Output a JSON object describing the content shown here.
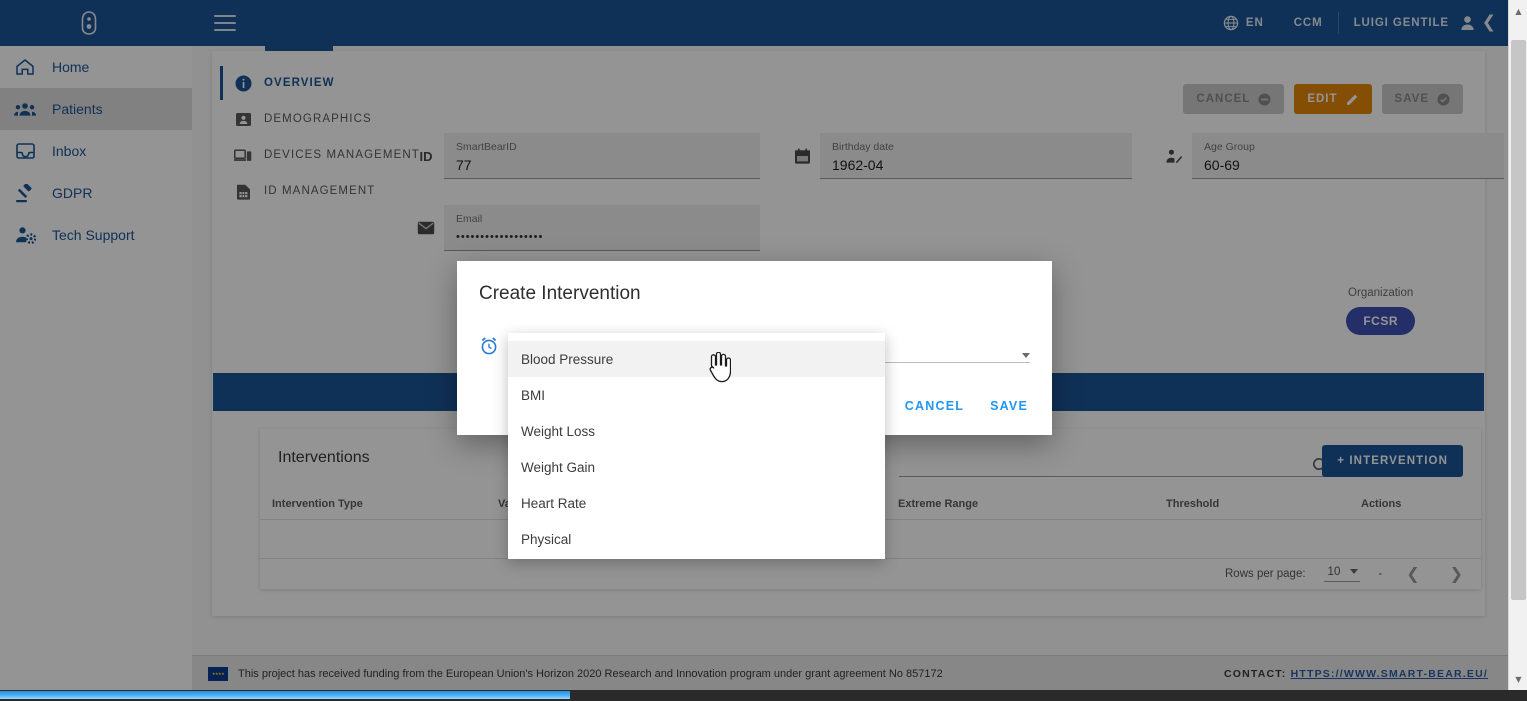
{
  "topbar": {
    "brand_icon": "bear-logo-icon",
    "collapse_icon": "chevron-left-icon",
    "menu_icon": "hamburger-menu-icon",
    "language": "EN",
    "project": "CCM",
    "user": "LUIGI GENTILE"
  },
  "sidebar": {
    "items": [
      {
        "label": "Home",
        "icon": "home-icon",
        "active": false
      },
      {
        "label": "Patients",
        "icon": "people-icon",
        "active": true
      },
      {
        "label": "Inbox",
        "icon": "inbox-icon",
        "active": false
      },
      {
        "label": "GDPR",
        "icon": "gavel-icon",
        "active": false
      },
      {
        "label": "Tech Support",
        "icon": "support-agent-icon",
        "active": false
      }
    ]
  },
  "section_tabs": [
    {
      "label": "OVERVIEW",
      "icon": "info-icon",
      "active": true
    },
    {
      "label": "DEMOGRAPHICS",
      "icon": "badge-person-icon",
      "active": false
    },
    {
      "label": "DEVICES MANAGEMENT",
      "icon": "devices-icon",
      "active": false
    },
    {
      "label": "ID MANAGEMENT",
      "icon": "sim-card-icon",
      "active": false
    }
  ],
  "actions": {
    "cancel": "CANCEL",
    "edit": "EDIT",
    "save": "SAVE"
  },
  "form": {
    "smartbear_id": {
      "label": "SmartBearID",
      "value": "77",
      "icon": "id-icon"
    },
    "birthday": {
      "label": "Birthday date",
      "value": "1962-04",
      "icon": "calendar-icon"
    },
    "age_group": {
      "label": "Age Group",
      "value": "60-69",
      "icon": "age-person-icon"
    },
    "email": {
      "label": "Email",
      "value": "••••••••••••••••••",
      "icon": "mail-icon"
    }
  },
  "organization": {
    "label": "Organization",
    "chip": "FCSR",
    "chip_color": "#3f51b5"
  },
  "interventions": {
    "title": "Interventions",
    "search_placeholder": "",
    "search_value": "",
    "add_button": "+ INTERVENTION",
    "columns": [
      "Intervention Type",
      "Value",
      "Extreme Range",
      "Threshold",
      "Actions"
    ],
    "rows": [
      [
        "",
        "",
        "",
        "",
        ""
      ]
    ],
    "pager": {
      "rows_per_page_label": "Rows per page:",
      "rows_per_page_value": "10",
      "range": "-",
      "prev_icon": "chevron-left-icon",
      "next_icon": "chevron-right-icon"
    }
  },
  "modal": {
    "title": "Create Intervention",
    "field_icon": "alarm-clock-icon",
    "field_value": "",
    "cancel": "CANCEL",
    "save": "SAVE"
  },
  "dropdown": {
    "items": [
      {
        "label": "Blood Pressure",
        "hover": true
      },
      {
        "label": "BMI",
        "hover": false
      },
      {
        "label": "Weight Loss",
        "hover": false
      },
      {
        "label": "Weight Gain",
        "hover": false
      },
      {
        "label": "Heart Rate",
        "hover": false
      },
      {
        "label": "Physical",
        "hover": false
      }
    ]
  },
  "footer": {
    "text": "This project has received funding from the European Union's Horizon 2020 Research and Innovation program under grant agreement No 857172",
    "contact_label": "CONTACT:",
    "contact_link": "HTTPS://WWW.SMART-BEAR.EU/"
  },
  "colors": {
    "header_blue": "#1d5596",
    "accent_orange": "#e3870a",
    "link_blue": "#2196f3",
    "chip_indigo": "#3f51b5"
  }
}
